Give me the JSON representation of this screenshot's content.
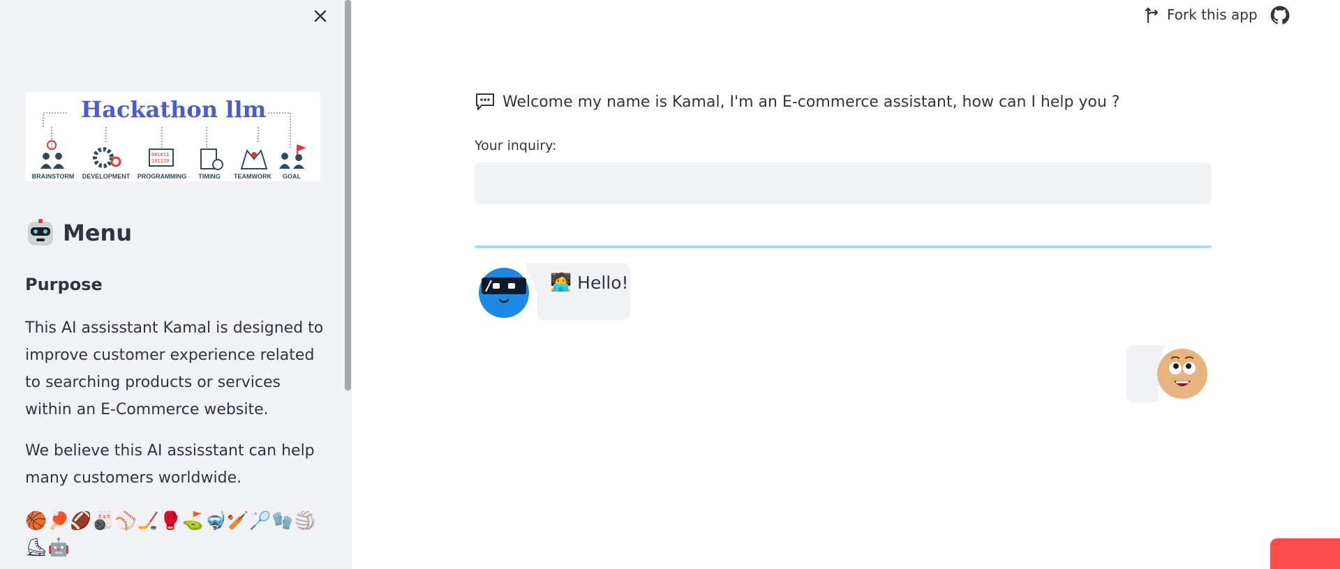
{
  "sidebar": {
    "close_label": "×",
    "banner": {
      "title": "Hackathon llm",
      "labels": [
        "BRAINSTORM",
        "DEVELOPMENT",
        "PROGRAMMING",
        "TIMING",
        "TEAMWORK",
        "GOAL"
      ],
      "program_text_1": "001011",
      "program_text_2": "101110"
    },
    "menu_icon": "robot-face-icon",
    "menu_title": "Menu",
    "purpose_heading": "Purpose",
    "purpose_text": "This AI assisstant Kamal is designed to improve customer experience related to searching products or services within an E-Commerce website.",
    "belief_text": "We believe this AI assisstant can help many customers worldwide.",
    "emoji_row": "🏀🏓🏈🎳⚾🏒🥊⛳🤿🏏🏸🧤🏐⛸🤖"
  },
  "header": {
    "fork_label": "Fork this app",
    "fork_icon": "fork-icon",
    "github_icon": "github-icon"
  },
  "main": {
    "welcome_icon": "speech-bubble-icon",
    "welcome_text": "Welcome my name is Kamal, I'm an E-commerce assistant, how can I help you ?",
    "inquiry_label": "Your inquiry:",
    "inquiry_value": "",
    "messages": [
      {
        "role": "bot",
        "emoji": "🧑‍💻",
        "text": "Hello!",
        "avatar": "robot-avatar-icon"
      },
      {
        "role": "user",
        "text": "",
        "avatar": "smiley-face-avatar-icon"
      }
    ]
  },
  "colors": {
    "sidebar_bg": "#f0f2f6",
    "text": "#31333f",
    "accent_divider": "#a8d8f5",
    "bot_avatar_bg": "#1e88e5",
    "badge": "#ff4b4b",
    "banner_title": "#4e5bd0"
  }
}
